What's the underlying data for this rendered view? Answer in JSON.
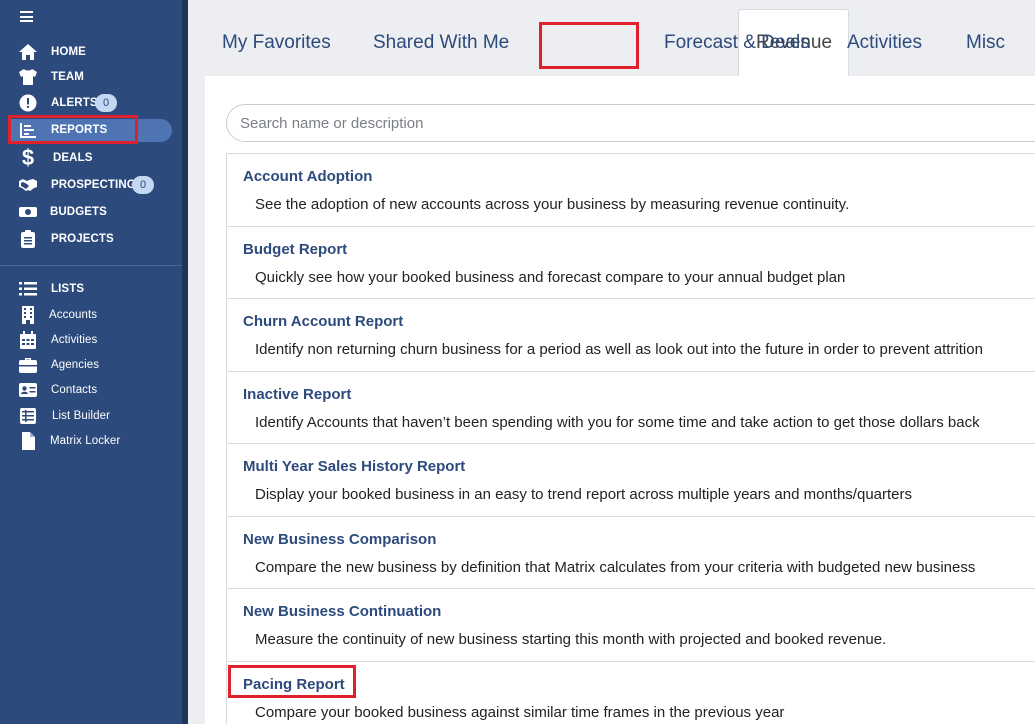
{
  "sidebar": {
    "main_items": [
      {
        "label": "HOME",
        "icon": "home-icon"
      },
      {
        "label": "TEAM",
        "icon": "shirt-icon"
      },
      {
        "label": "ALERTS",
        "icon": "alert-icon",
        "badge": "0"
      },
      {
        "label": "REPORTS",
        "icon": "chart-icon",
        "active": true
      },
      {
        "label": "DEALS",
        "icon": "dollar-icon"
      },
      {
        "label": "PROSPECTING",
        "icon": "handshake-icon",
        "badge": "0"
      },
      {
        "label": "BUDGETS",
        "icon": "money-icon"
      },
      {
        "label": "PROJECTS",
        "icon": "clipboard-icon"
      }
    ],
    "lists_header": "LISTS",
    "list_items": [
      {
        "label": "Accounts",
        "icon": "building-icon"
      },
      {
        "label": "Activities",
        "icon": "calendar-icon"
      },
      {
        "label": "Agencies",
        "icon": "briefcase-icon"
      },
      {
        "label": "Contacts",
        "icon": "contact-card-icon"
      },
      {
        "label": "List Builder",
        "icon": "list-table-icon"
      },
      {
        "label": "Matrix Locker",
        "icon": "file-icon"
      }
    ]
  },
  "tabs": [
    {
      "label": "My Favorites"
    },
    {
      "label": "Shared With Me"
    },
    {
      "label": "Revenue",
      "active": true
    },
    {
      "label": "Forecast & Deals"
    },
    {
      "label": "Activities"
    },
    {
      "label": "Misc"
    }
  ],
  "search": {
    "placeholder": "Search name or description"
  },
  "reports": [
    {
      "title": "Account Adoption",
      "description": "See the adoption of new accounts across your business by measuring revenue continuity."
    },
    {
      "title": "Budget Report",
      "description": "Quickly see how your booked business and forecast compare to your annual budget plan"
    },
    {
      "title": "Churn Account Report",
      "description": "Identify non returning churn business for a period as well as look out into the future in order to prevent attrition"
    },
    {
      "title": "Inactive Report",
      "description": "Identify Accounts that haven’t been spending with you for some time and take action to get those dollars back"
    },
    {
      "title": "Multi Year Sales History Report",
      "description": "Display your booked business in an easy to trend report across multiple years and months/quarters"
    },
    {
      "title": "New Business Comparison",
      "description": "Compare the new business by definition that Matrix calculates from your criteria with budgeted new business"
    },
    {
      "title": "New Business Continuation",
      "description": "Measure the continuity of new business starting this month with projected and booked revenue."
    },
    {
      "title": "Pacing Report",
      "description": "Compare your booked business against similar time frames in the previous year"
    }
  ],
  "colors": {
    "sidebar": "#2d4a7c",
    "active_pill": "#4f74b4",
    "highlight": "#e0202c",
    "link": "#2d4a7c"
  }
}
